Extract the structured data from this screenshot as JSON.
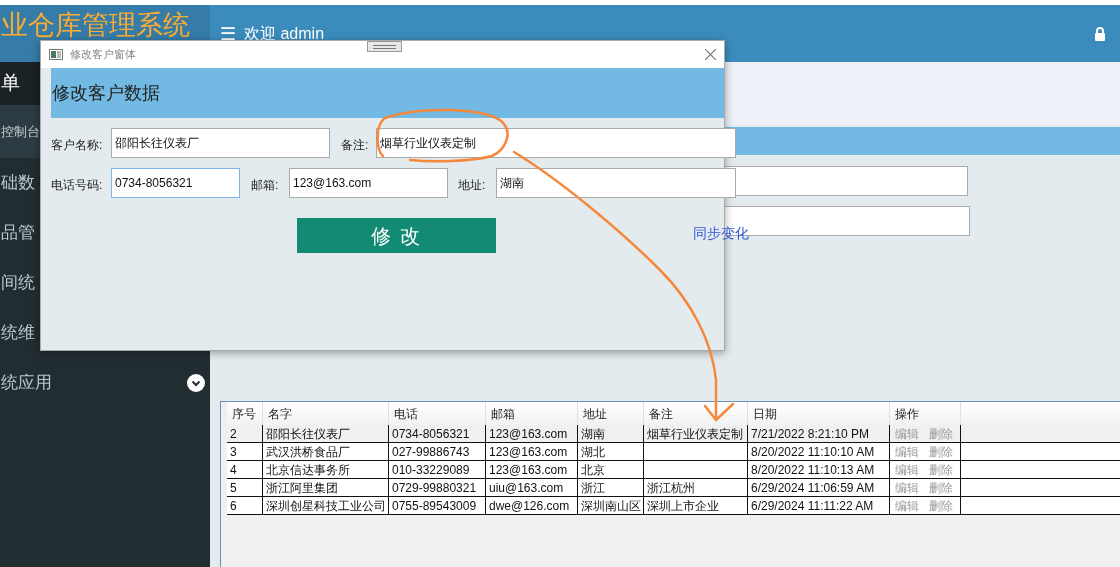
{
  "app": {
    "title": "业仓库管理系统",
    "welcome": "欢迎 admin",
    "menu_icon": "☰"
  },
  "sidebar": {
    "header": "单",
    "items": [
      {
        "label": "控制台",
        "selected": true
      },
      {
        "label": "础数",
        "selected": false
      },
      {
        "label": "品管",
        "selected": false
      },
      {
        "label": "间统",
        "selected": false
      },
      {
        "label": "统维",
        "selected": false
      },
      {
        "label": "统应用",
        "selected": false,
        "expandable": true
      }
    ]
  },
  "sync_link": "同步变化",
  "dialog": {
    "title": "修改客户窗体",
    "heading": "修改客户数据",
    "fields": [
      {
        "label": "客户名称:",
        "value": "邵阳长往仪表厂",
        "focused": false
      },
      {
        "label": "备注:",
        "value": "烟草行业仪表定制",
        "focused": false
      },
      {
        "label": "电话号码:",
        "value": "0734-8056321",
        "focused": true
      },
      {
        "label": "邮箱:",
        "value": "123@163.com",
        "focused": false
      },
      {
        "label": "地址:",
        "value": "湖南",
        "focused": false
      }
    ],
    "submit": "修 改"
  },
  "table": {
    "columns": [
      "序号",
      "名字",
      "电话",
      "邮箱",
      "地址",
      "备注",
      "日期",
      "操作"
    ],
    "rows": [
      {
        "selected": true,
        "cells": [
          "2",
          "邵阳长往仪表厂",
          "0734-8056321",
          "123@163.com",
          "湖南",
          "烟草行业仪表定制",
          "7/21/2022 8:21:10 PM"
        ],
        "actions": [
          "编辑",
          "删除"
        ]
      },
      {
        "selected": false,
        "cells": [
          "3",
          "武汉洪桥食品厂",
          "027-99886743",
          "123@163.com",
          "湖北",
          "",
          "8/20/2022 11:10:10 AM"
        ],
        "actions": [
          "编辑",
          "删除"
        ]
      },
      {
        "selected": false,
        "cells": [
          "4",
          "北京信达事务所",
          "010-33229089",
          "123@163.com",
          "北京",
          "",
          "8/20/2022 11:10:13 AM"
        ],
        "actions": [
          "编辑",
          "删除"
        ]
      },
      {
        "selected": false,
        "cells": [
          "5",
          "浙江阿里集团",
          "0729-99880321",
          "uiu@163.com",
          "浙江",
          "浙江杭州",
          "6/29/2024 11:06:59 AM"
        ],
        "actions": [
          "编辑",
          "删除"
        ]
      },
      {
        "selected": false,
        "cells": [
          "6",
          "深圳创星科技工业公司",
          "0755-89543009",
          "dwe@126.com",
          "深圳南山区",
          "深圳上市企业",
          "6/29/2024 11:11:22 AM"
        ],
        "actions": [
          "编辑",
          "删除"
        ]
      }
    ]
  }
}
